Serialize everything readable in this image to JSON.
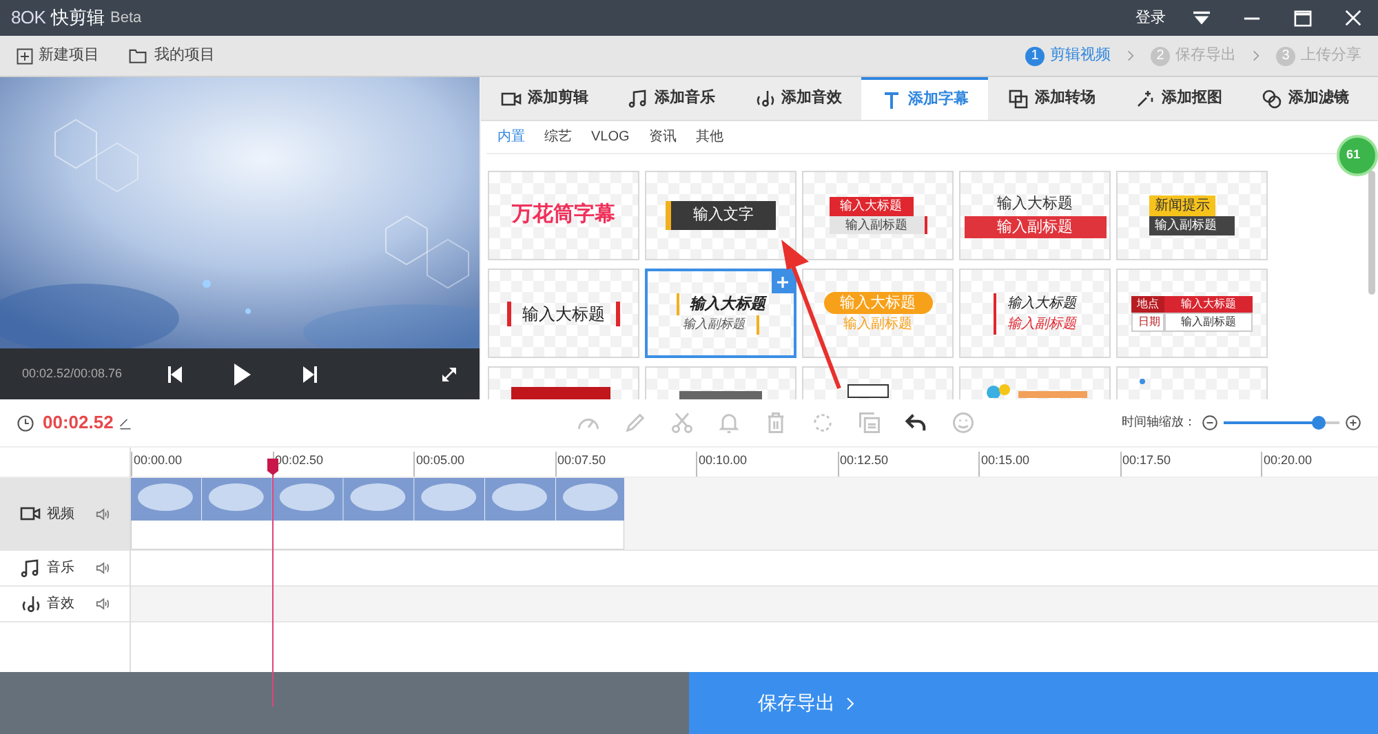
{
  "window": {
    "logo": "8OK",
    "title": "快剪辑",
    "badge": "Beta",
    "login": "登录"
  },
  "toolbar": {
    "buttons": [
      {
        "kind": "new",
        "label": "新建项目"
      },
      {
        "kind": "folder",
        "label": "我的项目"
      }
    ],
    "steps": [
      {
        "number": "1",
        "label": "剪辑视频",
        "selected": true
      },
      {
        "number": "2",
        "label": "保存导出",
        "selected": false
      },
      {
        "number": "3",
        "label": "上传分享",
        "selected": false
      }
    ]
  },
  "player": {
    "time": "00:02.52/00:08.76"
  },
  "tabs": [
    {
      "kind": "video",
      "label": "添加剪辑",
      "selected": false
    },
    {
      "kind": "music",
      "label": "添加音乐",
      "selected": false
    },
    {
      "kind": "sound",
      "label": "添加音效",
      "selected": false
    },
    {
      "kind": "text",
      "label": "添加字幕",
      "selected": true
    },
    {
      "kind": "transition",
      "label": "添加转场",
      "selected": false
    },
    {
      "kind": "cutout",
      "label": "添加抠图",
      "selected": false
    },
    {
      "kind": "filter",
      "label": "添加滤镜",
      "selected": false
    }
  ],
  "subtabs": [
    {
      "label": "内置",
      "selected": true
    },
    {
      "label": "综艺",
      "selected": false
    },
    {
      "label": "VLOG",
      "selected": false
    },
    {
      "label": "资讯",
      "selected": false
    },
    {
      "label": "其他",
      "selected": false
    }
  ],
  "floating_badge": "61",
  "templates": [
    {
      "kind": "plain-red",
      "selected": false,
      "title": "万花筒字幕"
    },
    {
      "kind": "dark-label",
      "selected": false,
      "title": "输入文字"
    },
    {
      "kind": "red-gray",
      "selected": false,
      "title": "输入大标题",
      "subtitle": "输入副标题"
    },
    {
      "kind": "fade-red",
      "selected": false,
      "title": "输入大标题",
      "subtitle": "输入副标题"
    },
    {
      "kind": "news",
      "selected": false,
      "title": "新闻提示",
      "subtitle": "输入副标题"
    },
    {
      "kind": "red-bars",
      "selected": false,
      "title": "输入大标题"
    },
    {
      "kind": "slash-italic",
      "selected": true,
      "title": "输入大标题",
      "subtitle": "输入副标题"
    },
    {
      "kind": "orange-pill",
      "selected": false,
      "title": "输入大标题",
      "subtitle": "输入副标题"
    },
    {
      "kind": "red-slash",
      "selected": false,
      "title": "输入大标题",
      "subtitle": "输入副标题"
    },
    {
      "kind": "table",
      "selected": false,
      "place": "地点",
      "date": "日期",
      "title": "输入大标题",
      "subtitle": "输入副标题"
    },
    {
      "kind": "partial-red",
      "selected": false
    },
    {
      "kind": "partial-gray",
      "selected": false
    },
    {
      "kind": "partial-tag",
      "selected": false
    },
    {
      "kind": "partial-colorful",
      "selected": false
    },
    {
      "kind": "partial-dot",
      "selected": false
    }
  ],
  "timeline": {
    "current_time": "00:02.52",
    "zoom_label": "时间轴缩放：",
    "zoom": {
      "level": 0.82
    },
    "tools": [
      {
        "kind": "speed",
        "disabled": true
      },
      {
        "kind": "pencil",
        "disabled": true
      },
      {
        "kind": "scissors",
        "disabled": true
      },
      {
        "kind": "bell",
        "disabled": true
      },
      {
        "kind": "trash",
        "disabled": true
      },
      {
        "kind": "magic",
        "disabled": true
      },
      {
        "kind": "copy",
        "disabled": true
      },
      {
        "kind": "undo",
        "disabled": false
      },
      {
        "kind": "smile",
        "disabled": true
      }
    ],
    "ruler": [
      "00:00.00",
      "00:02.50",
      "00:05.00",
      "00:07.50",
      "00:10.00",
      "00:12.50",
      "00:15.00",
      "00:17.50",
      "00:20.00"
    ],
    "tracks": [
      {
        "kind": "video",
        "label": "视频"
      },
      {
        "kind": "music",
        "label": "音乐"
      },
      {
        "kind": "sound",
        "label": "音效"
      }
    ]
  },
  "footer": {
    "export": "保存导出"
  }
}
